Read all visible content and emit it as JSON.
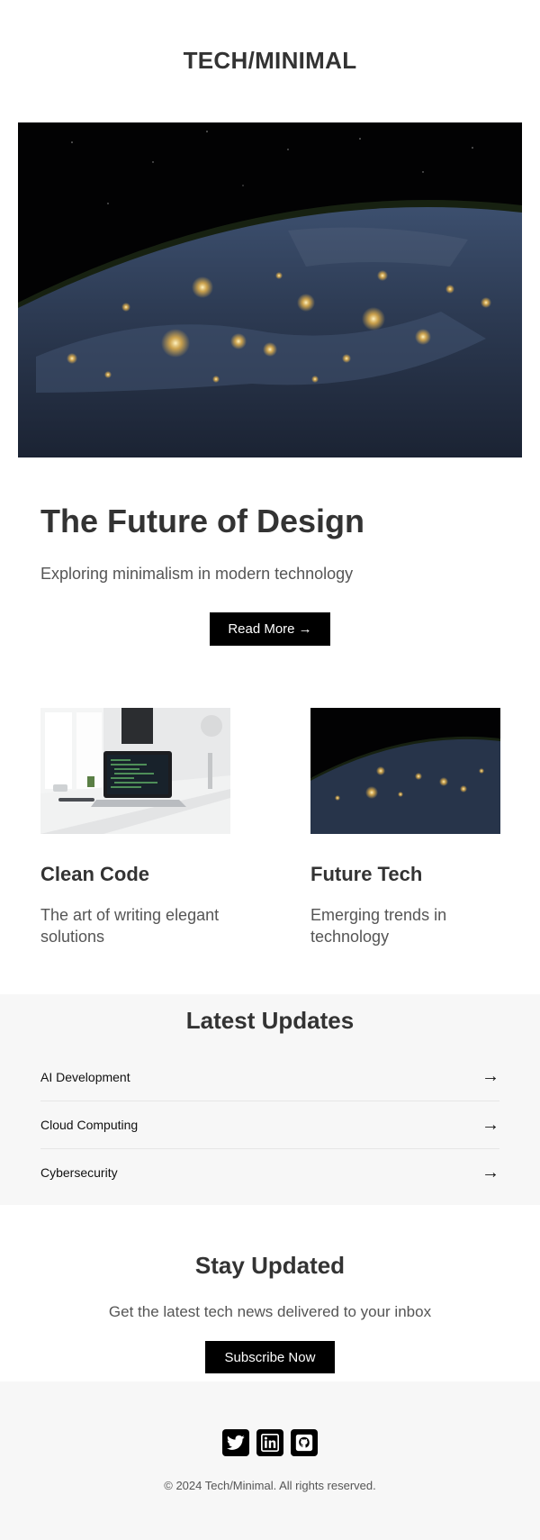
{
  "header": {
    "brand": "TECH/MINIMAL"
  },
  "hero": {
    "image_icon": "earth-night-image",
    "title": "The Future of Design",
    "subtitle": "Exploring minimalism in modern technology",
    "button_label": "Read More →"
  },
  "cards": [
    {
      "image_icon": "laptop-desk-image",
      "title": "Clean Code",
      "text": "The art of writing elegant solutions"
    },
    {
      "image_icon": "earth-night-image",
      "title": "Future Tech",
      "text": "Emerging trends in technology"
    }
  ],
  "updates": {
    "title": "Latest Updates",
    "items": [
      {
        "label": "AI Development",
        "arrow": "→"
      },
      {
        "label": "Cloud Computing",
        "arrow": "→"
      },
      {
        "label": "Cybersecurity",
        "arrow": "→"
      }
    ]
  },
  "subscribe": {
    "title": "Stay Updated",
    "text": "Get the latest tech news delivered to your inbox",
    "button_label": "Subscribe Now"
  },
  "footer": {
    "social_icons": [
      "twitter-icon",
      "linkedin-icon",
      "github-icon"
    ],
    "copyright": "© 2024 Tech/Minimal. All rights reserved."
  },
  "colors": {
    "text": "#333333",
    "muted": "#555555",
    "button": "#000000",
    "section_bg": "#f7f7f7"
  }
}
